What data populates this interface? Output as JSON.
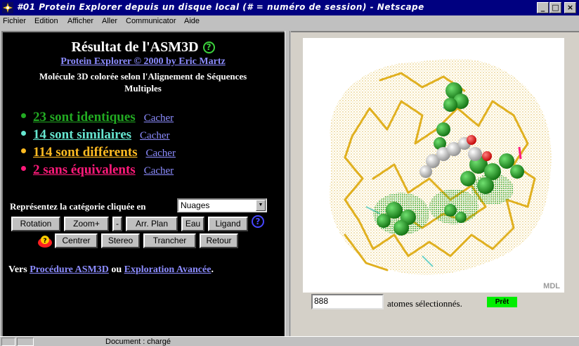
{
  "window": {
    "title": "#01 Protein Explorer depuis un disque local (# = numéro de session) - Netscape",
    "buttons": {
      "minimize": "_",
      "maximize": "□",
      "close": "×"
    }
  },
  "menu": [
    "Fichier",
    "Edition",
    "Afficher",
    "Aller",
    "Communicator",
    "Aide"
  ],
  "left": {
    "title": "Résultat de l'ASM3D",
    "credit_link": "Protein Explorer © 2000 by Eric Martz",
    "subtitle": "Molécule 3D colorée selon l'Alignement de Séquences Multiples",
    "categories": [
      {
        "label": "23 sont identiques",
        "hide": "Cacher",
        "color": "#22aa22"
      },
      {
        "label": "14 sont similaires",
        "hide": "Cacher",
        "color": "#66e6d0"
      },
      {
        "label": "114 sont différents",
        "hide": "Cacher",
        "color": "#ffbb22"
      },
      {
        "label": "2 sans équivalents",
        "hide": "Cacher",
        "color": "#ff1a7a"
      }
    ],
    "represent_label": "Représentez la catégorie cliquée en",
    "represent_value": "Nuages",
    "buttons_row1": [
      "Rotation",
      "Zoom+",
      "-",
      "Arr. Plan",
      "Eau",
      "Ligand"
    ],
    "buttons_row2": [
      "Centrer",
      "Stereo",
      "Trancher",
      "Retour"
    ],
    "help_glyph": "?",
    "footer": {
      "prefix": "Vers",
      "link1": "Procédure ASM3D",
      "middle": "ou",
      "link2": "Exploration Avancée",
      "suffix": "."
    }
  },
  "right": {
    "watermark": "MDL",
    "atom_count": "888",
    "atom_label": "atomes sélectionnés.",
    "status_badge": "Prêt"
  },
  "statusbar": {
    "text": "Document : chargé"
  },
  "colors": {
    "titlebar": "#000080",
    "link": "#8c8cff",
    "identical": "#22aa22",
    "similar": "#66e6d0",
    "different": "#ffbb22",
    "unmatched": "#ff1a7a",
    "ready": "#00ee00"
  }
}
